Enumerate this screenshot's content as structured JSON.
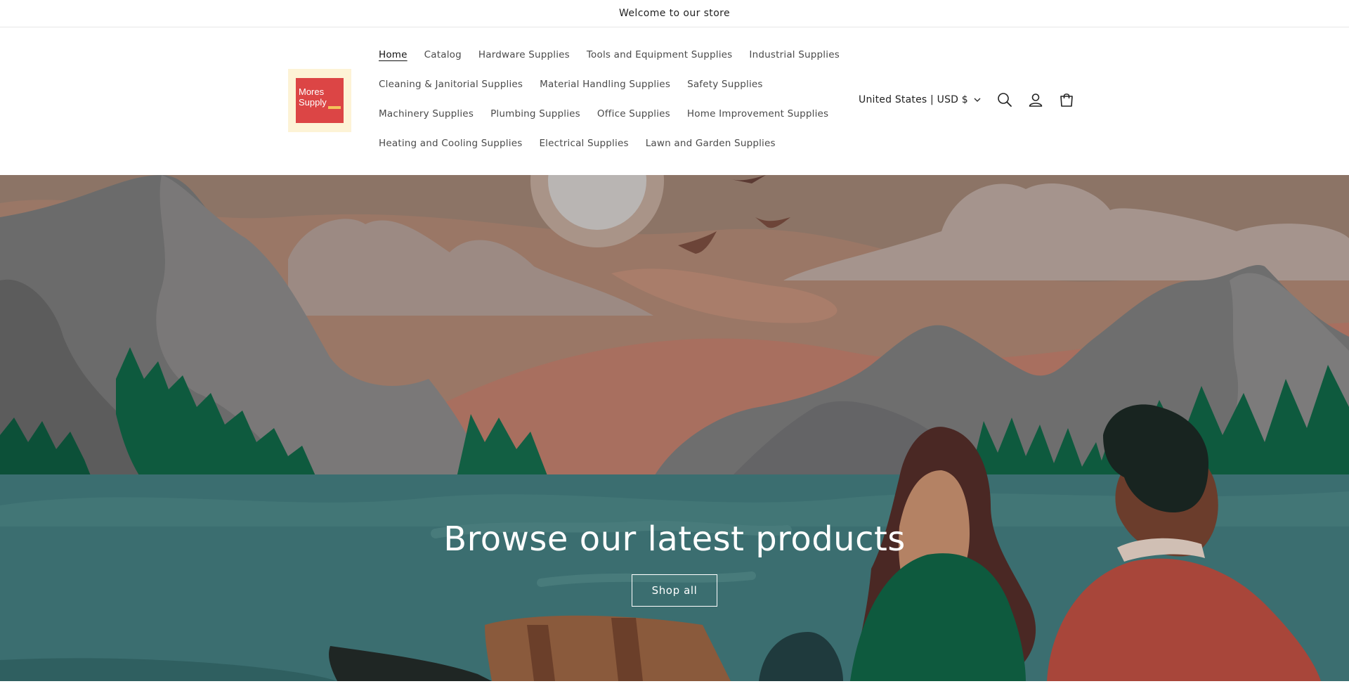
{
  "announcement": {
    "text": "Welcome to our store"
  },
  "logo": {
    "line1": "Mores",
    "line2": "Supply"
  },
  "nav": {
    "rows": [
      [
        "Home",
        "Catalog",
        "Hardware Supplies",
        "Tools and Equipment Supplies",
        "Industrial Supplies"
      ],
      [
        "Cleaning & Janitorial Supplies",
        "Material Handling Supplies",
        "Safety Supplies"
      ],
      [
        "Machinery Supplies",
        "Plumbing Supplies",
        "Office Supplies",
        "Home Improvement Supplies"
      ],
      [
        "Heating and Cooling Supplies",
        "Electrical Supplies",
        "Lawn and Garden Supplies"
      ]
    ],
    "active": "Home"
  },
  "header": {
    "localization": "United States | USD $",
    "icons": [
      "search-icon",
      "account-icon",
      "cart-icon"
    ]
  },
  "hero": {
    "title": "Browse our latest products",
    "button_label": "Shop all"
  },
  "colors": {
    "sky": "#9a7766",
    "water": "#3b6e70",
    "mountain": "#6a6a6a",
    "tree": "#0e5a3e",
    "logo_red": "#dc4545",
    "logo_bg": "#fdf3d6"
  }
}
